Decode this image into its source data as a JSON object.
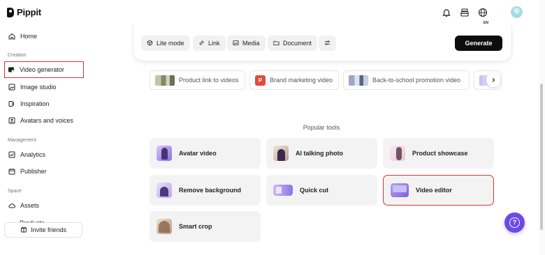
{
  "app": {
    "name": "Pippit"
  },
  "sidebar": {
    "home": "Home",
    "sections": {
      "creation": "Creation",
      "management": "Management",
      "space": "Space"
    },
    "creation_items": [
      {
        "label": "Video generator",
        "icon": "video-generator-icon",
        "active": true
      },
      {
        "label": "Image studio",
        "icon": "image-studio-icon"
      },
      {
        "label": "Inspiration",
        "icon": "inspiration-icon"
      },
      {
        "label": "Avatars and voices",
        "icon": "avatar-voice-icon"
      }
    ],
    "management_items": [
      {
        "label": "Analytics",
        "icon": "analytics-icon"
      },
      {
        "label": "Publisher",
        "icon": "calendar-icon"
      }
    ],
    "space_items": [
      {
        "label": "Assets",
        "icon": "cloud-icon"
      },
      {
        "label": "Products",
        "icon": "products-icon"
      }
    ],
    "invite_label": "Invite friends"
  },
  "topbar": {
    "language": "EN"
  },
  "input_toolbar": {
    "lite_mode": "Lite mode",
    "link": "Link",
    "media": "Media",
    "document": "Document",
    "generate": "Generate"
  },
  "suggestions": [
    "Product link to videos",
    "Brand marketing video",
    "Back-to-school promotion video"
  ],
  "brand_badge": "P",
  "popular_tools": {
    "title": "Popular tools",
    "items": [
      "Avatar video",
      "AI talking photo",
      "Product showcase",
      "Remove background",
      "Quick cut",
      "Video editor",
      "Smart crop"
    ]
  },
  "colors": {
    "accent": "#6b4be3",
    "highlight": "#d8352f",
    "generate_bg": "#0d0d0d"
  }
}
